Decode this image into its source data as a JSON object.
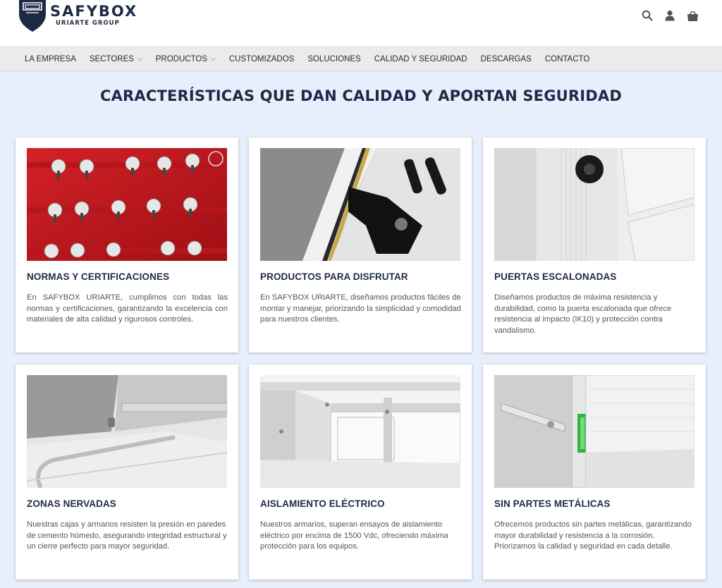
{
  "brand": {
    "name": "SAFYBOX",
    "sub": "URIARTE GROUP"
  },
  "header_icons": [
    "search-icon",
    "user-icon",
    "cart-icon"
  ],
  "nav": [
    {
      "label": "LA EMPRESA",
      "has_caret": false
    },
    {
      "label": "SECTORES",
      "has_caret": true
    },
    {
      "label": "PRODUCTOS",
      "has_caret": true
    },
    {
      "label": "CUSTOMIZADOS",
      "has_caret": false
    },
    {
      "label": "SOLUCIONES",
      "has_caret": false
    },
    {
      "label": "CALIDAD Y SEGURIDAD",
      "has_caret": false
    },
    {
      "label": "DESCARGAS",
      "has_caret": false
    },
    {
      "label": "CONTACTO",
      "has_caret": false
    }
  ],
  "section_title": "CARACTERÍSTICAS QUE DAN CALIDAD Y APORTAN SEGURIDAD",
  "cards": [
    {
      "title": "NORMAS Y CERTIFICACIONES",
      "text": "En SAFYBOX URIARTE, cumplimos con todas las normas y certificaciones, garantizando la excelencia con materiales de alta calidad y rigurosos controles."
    },
    {
      "title": "PRODUCTOS PARA DISFRUTAR",
      "text": "En SAFYBOX URIARTE, diseñamos productos fáciles de montar y manejar, priorizando la simplicidad y comodidad para nuestros clientes."
    },
    {
      "title": "PUERTAS ESCALONADAS",
      "text": "Diseñamos productos de máxima resistencia y durabilidad, como la puerta escalonada que ofrece resistencia al impacto (IK10) y protección contra vandalismo."
    },
    {
      "title": "ZONAS NERVADAS",
      "text": "Nuestras cajas y armarios resisten la presión en paredes de cemento húmedo, asegurando integridad estructural y un cierre perfecto para mayor seguridad."
    },
    {
      "title": "AISLAMIENTO ELÉCTRICO",
      "text": "Nuestros armarios, superan ensayos de aislamiento eléctrico por encima de 1500 Vdc, ofreciendo máxima protección para los equipos."
    },
    {
      "title": "SIN PARTES METÁLICAS",
      "text": "Ofrecemos productos sin partes metálicas, garantizando mayor durabilidad y resistencia a la corrosión. Priorizamos la calidad y seguridad en cada detalle."
    }
  ],
  "colors": {
    "navy": "#1e2a45",
    "page_bg": "#e8effc",
    "nav_bg": "#ebebeb",
    "accent_red": "#c8181e",
    "accent_green": "#2bb63a"
  }
}
